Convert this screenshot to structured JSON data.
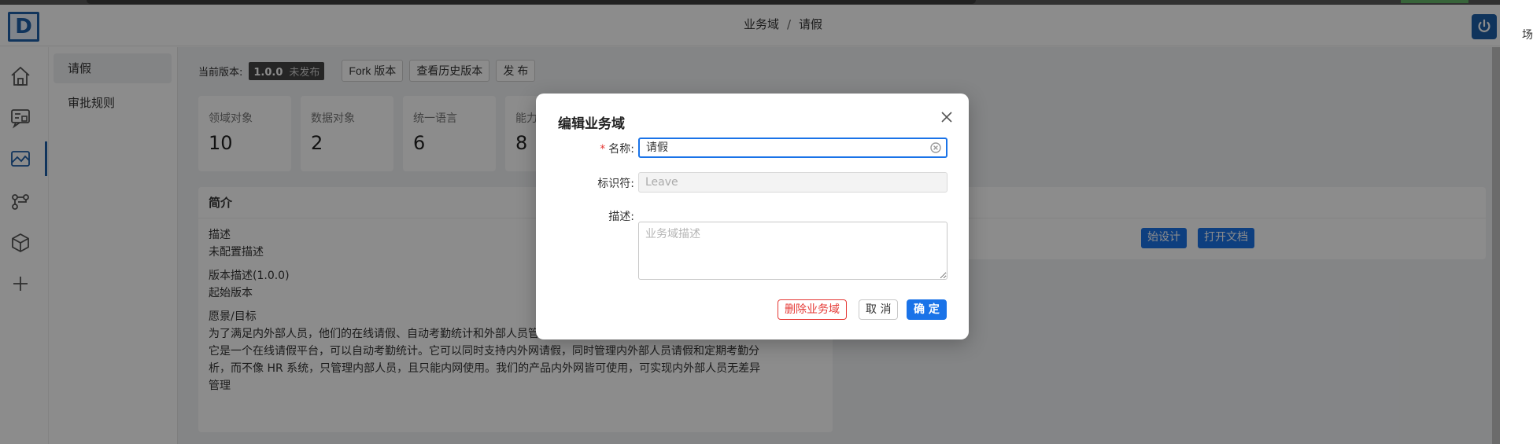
{
  "header": {
    "logo_letter": "D",
    "breadcrumb": [
      "业务域",
      "请假"
    ],
    "breadcrumb_sep": "/"
  },
  "rail": {
    "icons": [
      "home-icon",
      "chat-board-icon",
      "chart-image-icon",
      "flow-icon",
      "cube-icon",
      "plus-icon"
    ],
    "active_index": 2
  },
  "subnav": {
    "items": [
      "请假",
      "审批规则"
    ],
    "active_index": 0
  },
  "version_bar": {
    "label": "当前版本:",
    "version": "1.0.0",
    "status": "未发布",
    "fork_label": "Fork 版本",
    "history_label": "查看历史版本",
    "publish_label": "发 布"
  },
  "stats": [
    {
      "label": "领域对象",
      "value": "10"
    },
    {
      "label": "数据对象",
      "value": "2"
    },
    {
      "label": "统一语言",
      "value": "6"
    },
    {
      "label": "能力",
      "value": "8"
    }
  ],
  "intro": {
    "title": "简介",
    "desc_label": "描述",
    "desc_value": "未配置描述",
    "version_desc_label": "版本描述(1.0.0)",
    "version_desc_value": "起始版本",
    "vision_label": "愿景/目标",
    "vision_lines": [
      "为了满足内外部人员，他们的在线请假、自动考勤统计和外部人员管理的需求，我们建设这个在线请假考勤系统，",
      "它是一个在线请假平台，可以自动考勤统计。它可以同时支持内外网请假，同时管理内外部人员请假和定期考勤分",
      "析，而不像 HR 系统，只管理内部人员，且只能内网使用。我们的产品内外网皆可使用，可实现内外部人员无差异",
      "管理"
    ]
  },
  "design_card": {
    "start_design_label": "始设计",
    "open_doc_label": "打开文档"
  },
  "right_edge_text": "场",
  "modal": {
    "title": "编辑业务域",
    "required_mark": "*",
    "name_label": "名称:",
    "name_value": "请假",
    "identifier_label": "标识符:",
    "identifier_value": "Leave",
    "desc_label": "描述:",
    "desc_placeholder": "业务域描述",
    "delete_label": "删除业务域",
    "cancel_label": "取 消",
    "ok_label": "确 定"
  },
  "colors": {
    "brand": "#1e5fa8",
    "primary": "#1a73e8",
    "danger": "#e53935"
  }
}
